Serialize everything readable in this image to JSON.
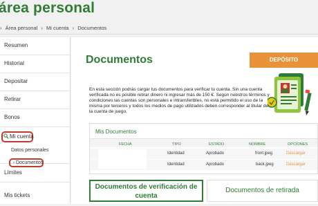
{
  "header": {
    "title": "área personal"
  },
  "breadcrumb": {
    "items": [
      "›",
      "Área personal",
      "›",
      "Mi cuenta",
      "›",
      "Documentos"
    ]
  },
  "sidebar": {
    "items": [
      "Resumen",
      "Historial",
      "Depositar",
      "Retirar",
      "Bonos",
      "Mi cuenta",
      "Límites",
      "Mis tickets"
    ],
    "sub_items": [
      "Datos personales",
      "Documentos"
    ],
    "active": "Documentos"
  },
  "main": {
    "title": "Documentos",
    "deposit_label": "DEPÓSITO",
    "intro": "En esta sección podrás cargar tus documentos para verificar tu cuenta. Sin una cuenta verificada no es posible retirar dinero ni ingresar más de 150 €. Según nuestros términos y condiciones las cuentas son personales e intransferibles, no está permitido el uso de la misma por terceros y todos los medios de pago utilizados deben corresponder al titular de la cuenta de juego.",
    "table": {
      "title": "Mis Documentos",
      "headers": [
        "FECHA",
        "TIPO",
        "ESTADO",
        "NOMBRE",
        "OPCIONES"
      ],
      "rows": [
        {
          "fecha": "",
          "tipo": "Identidad",
          "estado": "Aprobado",
          "nombre": "front.jpeg",
          "opcion": "Descargar"
        },
        {
          "fecha": "",
          "tipo": "Identidad",
          "estado": "Aprobado",
          "nombre": "back.jpeg",
          "opcion": "Descargar"
        }
      ]
    },
    "tabs": [
      "Documentos de verificación de cuenta",
      "Documentos de retirada"
    ]
  },
  "colors": {
    "brand_green": "#2f7d35",
    "accent_orange": "#e8923a",
    "highlight_red": "#c0392b"
  }
}
